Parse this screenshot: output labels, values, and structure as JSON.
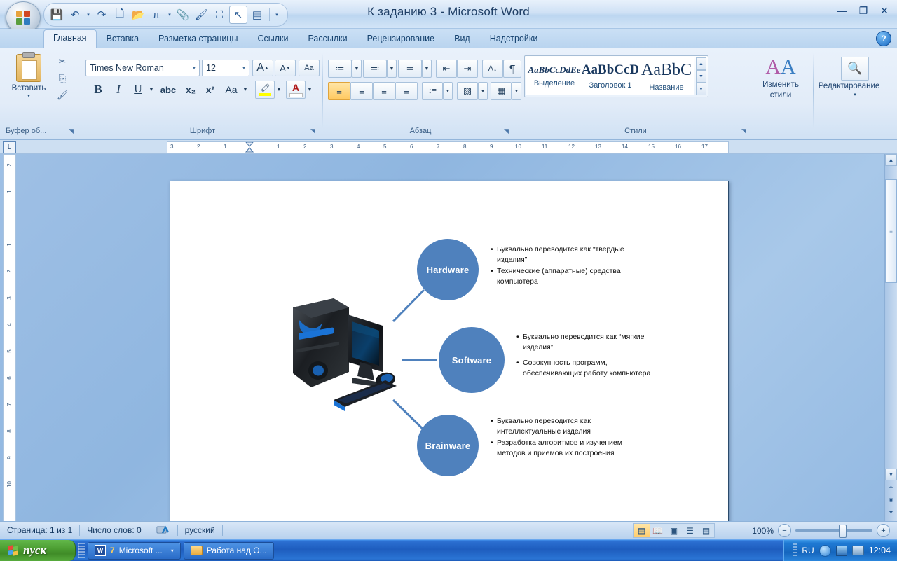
{
  "window": {
    "title": "К заданию 3 - Microsoft Word",
    "minimize": "—",
    "restore": "❐",
    "close": "✕",
    "help": "?"
  },
  "quick_access": {
    "items": [
      {
        "name": "save-icon",
        "glyph": "💾"
      },
      {
        "name": "undo-icon",
        "glyph": "↶"
      },
      {
        "name": "undo-dropdown-icon",
        "glyph": "▾"
      },
      {
        "name": "redo-icon",
        "glyph": "↷"
      },
      {
        "name": "new-document-icon",
        "glyph": "🗋"
      },
      {
        "name": "open-folder-icon",
        "glyph": "📂"
      },
      {
        "name": "formula-icon",
        "glyph": "π"
      },
      {
        "name": "formula-dropdown-icon",
        "glyph": "▾"
      },
      {
        "name": "attachment-icon",
        "glyph": "📎"
      },
      {
        "name": "format-painter-icon",
        "glyph": "🖌"
      },
      {
        "name": "select-objects-icon",
        "glyph": "⛶"
      },
      {
        "name": "pointer-icon",
        "glyph": "↖"
      },
      {
        "name": "select-region-icon",
        "glyph": "▤"
      },
      {
        "name": "customize-qat-icon",
        "glyph": "▾"
      }
    ]
  },
  "tabs": [
    {
      "label": "Главная",
      "active": true
    },
    {
      "label": "Вставка",
      "active": false
    },
    {
      "label": "Разметка страницы",
      "active": false
    },
    {
      "label": "Ссылки",
      "active": false
    },
    {
      "label": "Рассылки",
      "active": false
    },
    {
      "label": "Рецензирование",
      "active": false
    },
    {
      "label": "Вид",
      "active": false
    },
    {
      "label": "Надстройки",
      "active": false
    }
  ],
  "ribbon": {
    "clipboard": {
      "label": "Буфер об...",
      "paste": "Вставить",
      "paste_caret": "▾",
      "cut_icon": "✂",
      "copy_icon": "⎘",
      "painter_icon": "🖌"
    },
    "font": {
      "label": "Шрифт",
      "font_name": "Times New Roman",
      "font_size": "12",
      "grow_font": "A",
      "shrink_font": "A",
      "clear_format": "Aa",
      "bold": "B",
      "italic": "I",
      "underline": "U",
      "strikethrough": "abc",
      "subscript": "x₂",
      "superscript": "x²",
      "change_case": "Aa",
      "highlight": "🖍",
      "font_color": "A"
    },
    "paragraph": {
      "label": "Абзац",
      "bullets": "≔",
      "numbering": "≕",
      "multilevel": "≖",
      "decrease_indent": "⇤",
      "increase_indent": "⇥",
      "sort": "A↓",
      "show_marks": "¶",
      "align_left": "≡",
      "align_center": "≡",
      "align_right": "≡",
      "justify": "≡",
      "line_spacing": "↕≡",
      "shading": "▨",
      "borders": "▦"
    },
    "styles": {
      "label": "Стили",
      "gallery": [
        {
          "preview": "AaBbCcDdEe",
          "name": "Выделение",
          "style": "italic-serif"
        },
        {
          "preview": "AaBbCcD",
          "name": "Заголовок 1",
          "style": "bold-serif"
        },
        {
          "preview": "AaBbC",
          "name": "Название",
          "style": "large-serif"
        }
      ],
      "scroll_up": "▲",
      "scroll_down": "▼",
      "more": "▼",
      "change_styles_line1": "Изменить",
      "change_styles_line2": "стили",
      "change_styles_caret": "▾"
    },
    "editing": {
      "label": "Редактирование",
      "find_icon": "🔍",
      "caret": "▾"
    }
  },
  "ruler": {
    "tab_stop_icon": "L",
    "horizontal_marks": [
      "3",
      "2",
      "1",
      "1",
      "2",
      "3",
      "4",
      "5",
      "6",
      "7",
      "8",
      "9",
      "10",
      "11",
      "12",
      "13",
      "14",
      "15",
      "16",
      "17"
    ],
    "vertical_marks": [
      "2",
      "1",
      "1",
      "2",
      "3",
      "4",
      "5",
      "6",
      "7",
      "8",
      "9",
      "10"
    ]
  },
  "document": {
    "smartart": {
      "nodes": [
        {
          "title": "Hardware",
          "bullets": [
            "Буквально переводится как “твердые  изделия”",
            "Технические (аппаратные) средства компьютера"
          ]
        },
        {
          "title": "Software",
          "bullets": [
            "Буквально переводится как “мягкие изделия”",
            "Совокупность программ, обеспечивающих работу компьютера"
          ]
        },
        {
          "title": "Brainware",
          "bullets": [
            "Буквально переводится как интеллектуальные изделия",
            "Разработка алгоритмов и изучением методов и приемов их построения"
          ]
        }
      ],
      "image_name": "computer-desktop-illustration",
      "accent_color": "#4f81bd"
    }
  },
  "status_bar": {
    "page": "Страница: 1 из 1",
    "words": "Число слов: 0",
    "proofing_icon": "✓",
    "language": "русский",
    "view_buttons": [
      {
        "name": "print-layout-view",
        "glyph": "▤",
        "active": true
      },
      {
        "name": "full-screen-reading-view",
        "glyph": "📖",
        "active": false
      },
      {
        "name": "web-layout-view",
        "glyph": "▣",
        "active": false
      },
      {
        "name": "outline-view",
        "glyph": "☰",
        "active": false
      },
      {
        "name": "draft-view",
        "glyph": "▤",
        "active": false
      }
    ],
    "zoom_level": "100%",
    "zoom_out": "−",
    "zoom_in": "+"
  },
  "scrollbar": {
    "up_arrow": "▲",
    "down_arrow": "▼",
    "previous_page": "⏶",
    "select_browse_object": "◉",
    "next_page": "⏷",
    "split_icon": "▭"
  },
  "taskbar": {
    "start_label": "пуск",
    "buttons": [
      {
        "name": "taskbar-word-group",
        "count": "7",
        "label": "Microsoft ...",
        "caret": "▾",
        "icon": "W"
      },
      {
        "name": "taskbar-folder-window",
        "label": "Работа над О...",
        "icon": "folder"
      }
    ],
    "tray": {
      "language": "RU",
      "icons": [
        "action-center-icon",
        "network-icon",
        "display-icon"
      ],
      "clock": "12:04"
    }
  }
}
